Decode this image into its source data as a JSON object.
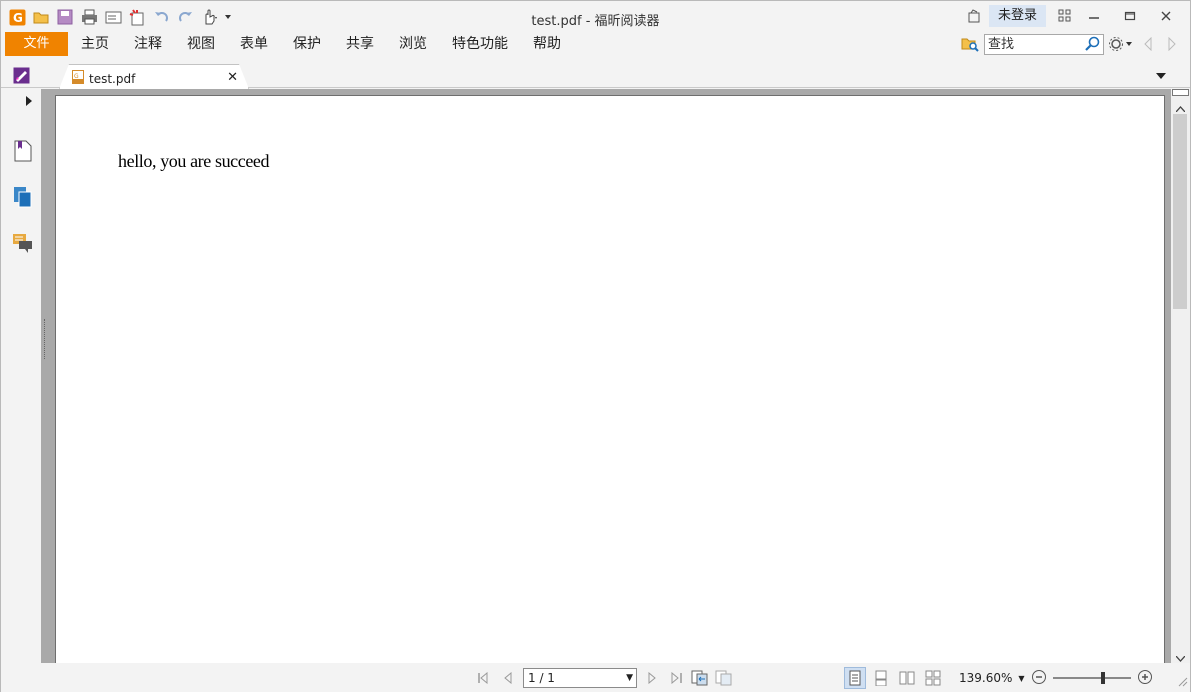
{
  "window": {
    "title": "test.pdf - 福昕阅读器",
    "login_label": "未登录"
  },
  "quick_access": {
    "icons": [
      "app-logo-icon",
      "open-folder-icon",
      "save-icon",
      "print-icon",
      "scan-icon",
      "new-icon",
      "undo-icon",
      "redo-icon",
      "hand-tool-icon",
      "customize-dropdown-icon"
    ]
  },
  "menubar": {
    "file_label": "文件",
    "items": [
      "主页",
      "注释",
      "视图",
      "表单",
      "保护",
      "共享",
      "浏览",
      "特色功能",
      "帮助"
    ]
  },
  "search": {
    "placeholder": "查找"
  },
  "tabs": {
    "doc_name": "test.pdf"
  },
  "document": {
    "text": "hello, you are succeed"
  },
  "statusbar": {
    "page_value": "1 / 1",
    "zoom_value": "139.60%"
  },
  "colors": {
    "accent_orange": "#f08300",
    "login_bg": "#dbe6f4",
    "viewer_bg": "#a9a9a9"
  }
}
